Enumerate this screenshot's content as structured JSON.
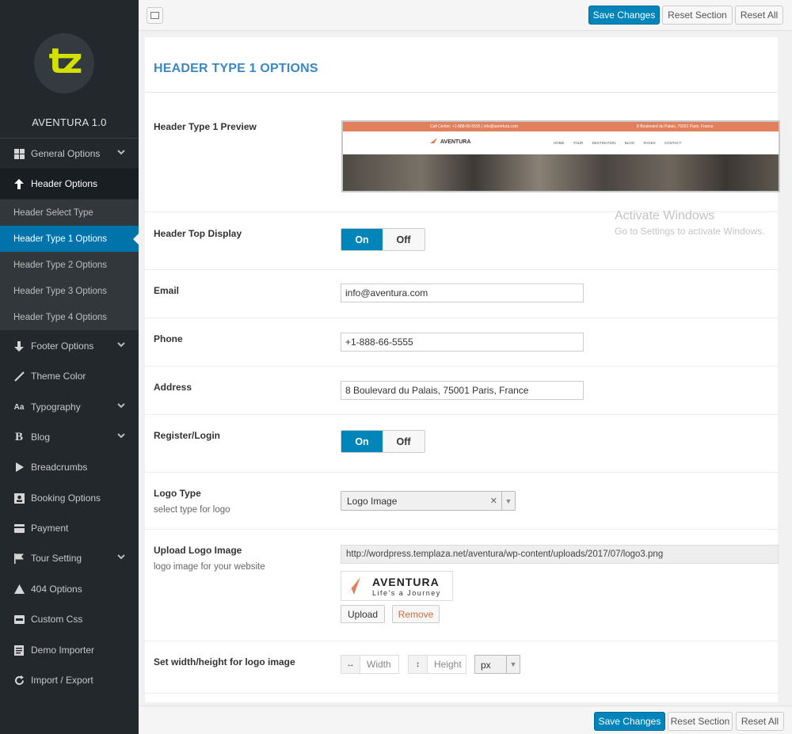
{
  "app": {
    "logo_text": "tz",
    "brand": "AVENTURA 1.0"
  },
  "colors": {
    "primary": "#0085ba",
    "sidebar_bg": "#23282d",
    "title_blue": "#3b88c3",
    "logo_yellow": "#d4e000",
    "brand_orange": "#e0805c"
  },
  "sidebar": {
    "items": [
      {
        "label": "General Options",
        "icon": "grid-icon",
        "has_chevron": true
      },
      {
        "label": "Header Options",
        "icon": "arrow-up-icon",
        "has_chevron": false,
        "expanded": true
      },
      {
        "label": "Footer Options",
        "icon": "arrow-down-icon",
        "has_chevron": true
      },
      {
        "label": "Theme Color",
        "icon": "brush-icon",
        "has_chevron": false
      },
      {
        "label": "Typography",
        "icon": "typography-icon",
        "has_chevron": true
      },
      {
        "label": "Blog",
        "icon": "bold-b-icon",
        "has_chevron": true
      },
      {
        "label": "Breadcrumbs",
        "icon": "play-icon",
        "has_chevron": false
      },
      {
        "label": "Booking Options",
        "icon": "contact-card-icon",
        "has_chevron": false
      },
      {
        "label": "Payment",
        "icon": "card-icon",
        "has_chevron": false
      },
      {
        "label": "Tour Setting",
        "icon": "flag-icon",
        "has_chevron": true
      },
      {
        "label": "404 Options",
        "icon": "warning-icon",
        "has_chevron": false
      },
      {
        "label": "Custom Css",
        "icon": "css-icon",
        "has_chevron": false
      },
      {
        "label": "Demo Importer",
        "icon": "document-icon",
        "has_chevron": false
      },
      {
        "label": "Import / Export",
        "icon": "refresh-icon",
        "has_chevron": false
      }
    ],
    "sub_items": [
      {
        "label": "Header Select Type",
        "active": false
      },
      {
        "label": "Header Type 1 Options",
        "active": true
      },
      {
        "label": "Header Type 2 Options",
        "active": false
      },
      {
        "label": "Header Type 3 Options",
        "active": false
      },
      {
        "label": "Header Type 4 Options",
        "active": false
      }
    ]
  },
  "toolbar": {
    "save_label": "Save Changes",
    "reset_section_label": "Reset Section",
    "reset_all_label": "Reset All"
  },
  "section": {
    "title": "HEADER TYPE 1 OPTIONS"
  },
  "fields": {
    "preview_label": "Header Type 1 Preview",
    "preview": {
      "top_left": "Call Center: +1-888-66-5555  |  info@aventura.com",
      "top_right": "8 Boulevard du Palais, 75001 Paris, France",
      "logo": "AVENTURA",
      "menu": "HOME TOUR DESTINATION BLOG PAGES CONTACT"
    },
    "header_top_display_label": "Header Top Display",
    "on_label": "On",
    "off_label": "Off",
    "email_label": "Email",
    "email_value": "info@aventura.com",
    "phone_label": "Phone",
    "phone_value": "+1-888-66-5555",
    "address_label": "Address",
    "address_value": "8 Boulevard du Palais, 75001 Paris, France",
    "register_label": "Register/Login",
    "logo_type_label": "Logo Type",
    "logo_type_desc": "select type for logo",
    "logo_type_value": "Logo Image",
    "upload_label": "Upload Logo Image",
    "upload_desc": "logo image for your website",
    "upload_url": "http://wordpress.templaza.net/aventura/wp-content/uploads/2017/07/logo3.png",
    "logo_preview_title": "AVENTURA",
    "logo_preview_sub": "Life's a Journey",
    "upload_button": "Upload",
    "remove_button": "Remove",
    "dimensions_label": "Set width/height for logo image",
    "width_placeholder": "Width",
    "height_placeholder": "Height",
    "unit_value": "px"
  },
  "watermark": {
    "line1": "Activate Windows",
    "line2": "Go to Settings to activate Windows."
  }
}
